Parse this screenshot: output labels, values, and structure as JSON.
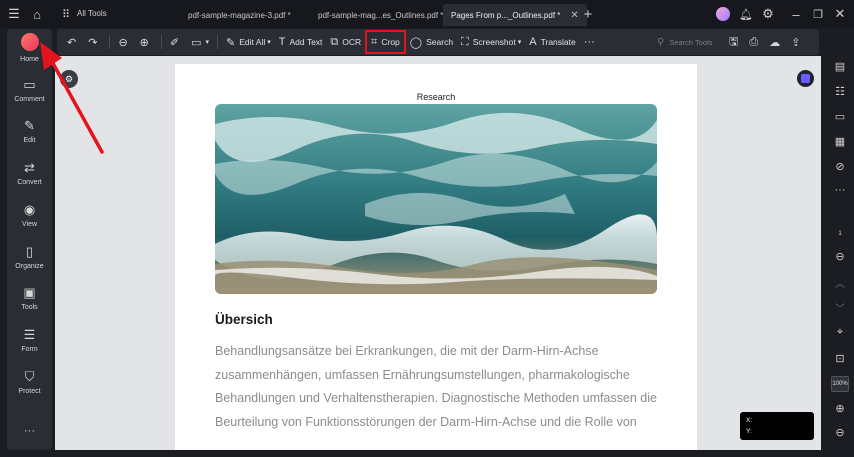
{
  "titlebar": {
    "all_tools": "All Tools",
    "tabs": [
      {
        "label": "pdf-sample-magazine-3.pdf *"
      },
      {
        "label": "pdf-sample-mag...es_Outlines.pdf *"
      },
      {
        "label": "Pages From p..._Outlines.pdf *",
        "active": true
      }
    ]
  },
  "toolbar": {
    "edit_all": "Edit All",
    "add_text": "Add Text",
    "ocr": "OCR",
    "crop": "Crop",
    "search": "Search",
    "screenshot": "Screenshot",
    "translate": "Translate",
    "search_tools_placeholder": "Search Tools"
  },
  "sidebar": {
    "items": [
      {
        "label": "Home",
        "icon": "home-icon"
      },
      {
        "label": "Comment",
        "icon": "comment-icon"
      },
      {
        "label": "Edit",
        "icon": "edit-icon"
      },
      {
        "label": "Convert",
        "icon": "convert-icon"
      },
      {
        "label": "View",
        "icon": "view-icon"
      },
      {
        "label": "Organize",
        "icon": "organize-icon"
      },
      {
        "label": "Tools",
        "icon": "tools-icon"
      },
      {
        "label": "Form",
        "icon": "form-icon"
      },
      {
        "label": "Protect",
        "icon": "protect-icon"
      }
    ]
  },
  "rightbar": {
    "page_number": "1",
    "zoom": "100%"
  },
  "document": {
    "header": "Research",
    "heading": "Übersich",
    "body": "Behandlungsansätze bei Erkrankungen, die mit der Darm-Hirn-Achse zusammenhängen, umfassen Ernährungsumstellungen, pharmakologische Behandlungen und Verhaltenstherapien. Diagnostische Methoden umfassen die Beurteilung von Funktionsstörungen der Darm-Hirn-Achse und die Rolle von"
  },
  "coords": {
    "x_label": "X:",
    "y_label": "Y:"
  },
  "colors": {
    "highlight": "#e3141b",
    "annotation_arrow": "#e3141b",
    "accent": "#6b5cff"
  }
}
